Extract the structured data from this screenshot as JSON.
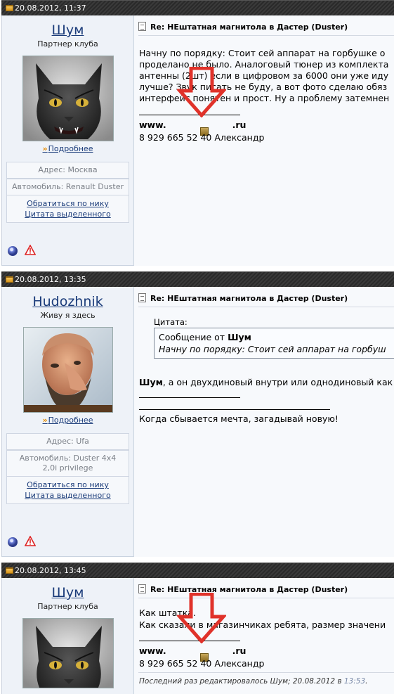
{
  "posts": [
    {
      "date": "20.08.2012, 11:37",
      "username": "Шум",
      "usertitle": "Партнер клуба",
      "more": "Подробнее",
      "address": "Адрес: Москва",
      "car": "Автомобиль: Renault Duster",
      "car2": "",
      "reply_by_nick": "Обратиться по нику",
      "quote_selected": "Цитата выделенного",
      "title": "Re: НЕштатная магнитола в Дастер (Duster)",
      "lines": [
        "Начну по порядку: Стоит сей аппарат на горбушке о",
        "проделано не было. Аналоговый тюнер из комплекта",
        "антенны (2шт) если в цифровом за 6000 они уже иду",
        "лучше? Звук писать не буду, а вот фото сделаю обяз",
        "интерфейс понятен и прост. Ну а проблему затемнен"
      ],
      "site_prefix": "www.",
      "site_suffix": ".ru",
      "phone": "8 929 665 52 40 Александр"
    },
    {
      "date": "20.08.2012, 13:35",
      "username": "Hudozhnik",
      "usertitle": "Живу я здесь",
      "more": "Подробнее",
      "address": "Адрес: Ufa",
      "car": "Автомобиль: Duster 4x4",
      "car2": "2,0i privilege",
      "reply_by_nick": "Обратиться по нику",
      "quote_selected": "Цитата выделенного",
      "title": "Re: НЕштатная магнитола в Дастер (Duster)",
      "quote_label": "Цитата:",
      "quote_from_prefix": "Сообщение от ",
      "quote_from_name": "Шум",
      "quote_text": "Начну по порядку: Стоит сей аппарат на горбуш",
      "reply_name": "Шум",
      "reply_text": ", а он двухдиновый внутри или однодиновый как",
      "signature": "Когда сбывается мечта, загадывай новую!"
    },
    {
      "date": "20.08.2012, 13:45",
      "username": "Шум",
      "usertitle": "Партнер клуба",
      "title": "Re: НЕштатная магнитола в Дастер (Duster)",
      "lines": [
        "Как штатка.",
        "Как сказали в магазинчиках ребята, размер значени"
      ],
      "site_prefix": "www.",
      "site_suffix": ".ru",
      "phone": "8 929 665 52 40 Александр",
      "edited_prefix": "Последний раз редактировалось Шум; 20.08.2012 в ",
      "edited_time": "13:53",
      "edited_suffix": "."
    }
  ],
  "colors": {
    "link": "#1b3c7a",
    "panel": "#eef2f8",
    "header": "#2e2e2e",
    "arrow": "#e0322a"
  },
  "icons": [
    "folder-icon",
    "document-icon",
    "online-status-icon",
    "report-warning-icon",
    "red-down-arrow",
    "chevron-down-icon"
  ]
}
